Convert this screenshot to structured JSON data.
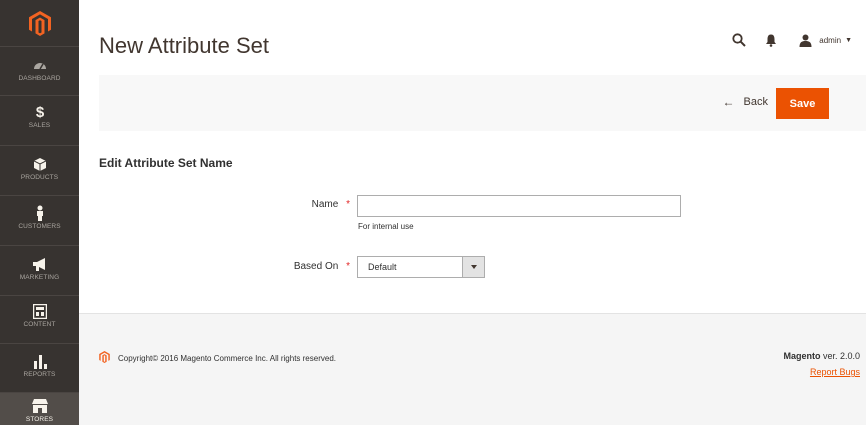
{
  "sidebar": {
    "items": [
      {
        "label": "DASHBOARD",
        "icon": "dashboard-icon"
      },
      {
        "label": "SALES",
        "icon": "dollar-icon"
      },
      {
        "label": "PRODUCTS",
        "icon": "cube-icon"
      },
      {
        "label": "CUSTOMERS",
        "icon": "person-icon"
      },
      {
        "label": "MARKETING",
        "icon": "megaphone-icon"
      },
      {
        "label": "CONTENT",
        "icon": "layout-icon"
      },
      {
        "label": "REPORTS",
        "icon": "bar-chart-icon"
      },
      {
        "label": "STORES",
        "icon": "store-icon"
      }
    ]
  },
  "header": {
    "title": "New Attribute Set",
    "user": "admin"
  },
  "actions": {
    "back_label": "Back",
    "save_label": "Save"
  },
  "form": {
    "section_title": "Edit Attribute Set Name",
    "name_label": "Name",
    "name_value": "",
    "name_hint": "For internal use",
    "based_on_label": "Based On",
    "based_on_value": "Default",
    "required_mark": "*"
  },
  "footer": {
    "copyright": "Copyright© 2016 Magento Commerce Inc. All rights reserved.",
    "brand": "Magento",
    "version": " ver. 2.0.0",
    "report_bugs": "Report Bugs"
  },
  "colors": {
    "accent": "#eb5202",
    "sidebar_bg": "#373330",
    "required": "#e22626"
  }
}
